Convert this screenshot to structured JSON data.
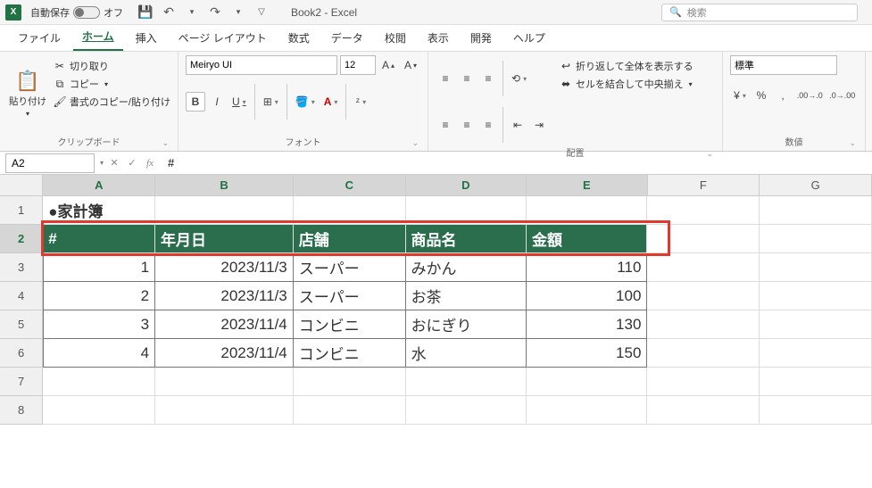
{
  "titlebar": {
    "autosave_label": "自動保存",
    "autosave_state": "オフ",
    "doc_title": "Book2 - Excel",
    "search_placeholder": "検索"
  },
  "tabs": [
    "ファイル",
    "ホーム",
    "挿入",
    "ページ レイアウト",
    "数式",
    "データ",
    "校閲",
    "表示",
    "開発",
    "ヘルプ"
  ],
  "active_tab": "ホーム",
  "ribbon": {
    "clipboard": {
      "paste": "貼り付け",
      "cut": "切り取り",
      "copy": "コピー",
      "format_painter": "書式のコピー/貼り付け",
      "group": "クリップボード"
    },
    "font": {
      "name": "Meiryo UI",
      "size": "12",
      "group": "フォント"
    },
    "alignment": {
      "wrap": "折り返して全体を表示する",
      "merge": "セルを結合して中央揃え",
      "group": "配置"
    },
    "number": {
      "format": "標準",
      "group": "数値"
    }
  },
  "fxbar": {
    "namebox": "A2",
    "formula": "#"
  },
  "columns": [
    "A",
    "B",
    "C",
    "D",
    "E",
    "F",
    "G"
  ],
  "sheet": {
    "title_cell": "●家計簿",
    "headers": [
      "#",
      "年月日",
      "店舗",
      "商品名",
      "金額"
    ],
    "rows": [
      {
        "n": "1",
        "date": "2023/11/3",
        "store": "スーパー",
        "item": "みかん",
        "amount": "110"
      },
      {
        "n": "2",
        "date": "2023/11/3",
        "store": "スーパー",
        "item": "お茶",
        "amount": "100"
      },
      {
        "n": "3",
        "date": "2023/11/4",
        "store": "コンビニ",
        "item": "おにぎり",
        "amount": "130"
      },
      {
        "n": "4",
        "date": "2023/11/4",
        "store": "コンビニ",
        "item": "水",
        "amount": "150"
      }
    ]
  }
}
